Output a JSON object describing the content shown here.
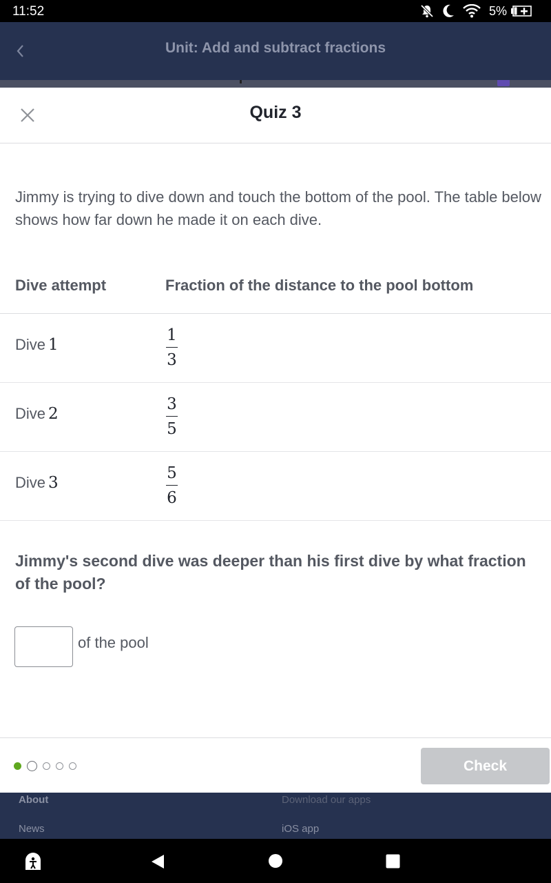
{
  "status_bar": {
    "time": "11:52",
    "battery": "5%"
  },
  "app_header": {
    "title": "Unit: Add and subtract fractions"
  },
  "modal": {
    "title": "Quiz 3",
    "intro": "Jimmy is trying to dive down and touch the bottom of the pool. The table below shows how far down he made it on each dive.",
    "table": {
      "headers": [
        "Dive attempt",
        "Fraction of the distance to the pool bottom"
      ],
      "rows": [
        {
          "label": "Dive",
          "number": "1",
          "numerator": "1",
          "denominator": "3"
        },
        {
          "label": "Dive",
          "number": "2",
          "numerator": "3",
          "denominator": "5"
        },
        {
          "label": "Dive",
          "number": "3",
          "numerator": "5",
          "denominator": "6"
        }
      ]
    },
    "question": "Jimmy's second dive was deeper than his first dive by what fraction of the pool?",
    "answer": {
      "value": "",
      "suffix": "of the pool"
    },
    "footer": {
      "check_label": "Check"
    }
  },
  "colors": {
    "progress_done": "#5fa81f",
    "header_bg": "#263250",
    "check_disabled": "#c6c8cb"
  },
  "site_footer": {
    "left_links": [
      "About",
      "News"
    ],
    "right_links": [
      "Download our apps",
      "iOS app"
    ]
  },
  "nav": {
    "icons": [
      "accessibility-icon",
      "back-triangle-icon",
      "home-circle-icon",
      "recents-square-icon"
    ]
  }
}
